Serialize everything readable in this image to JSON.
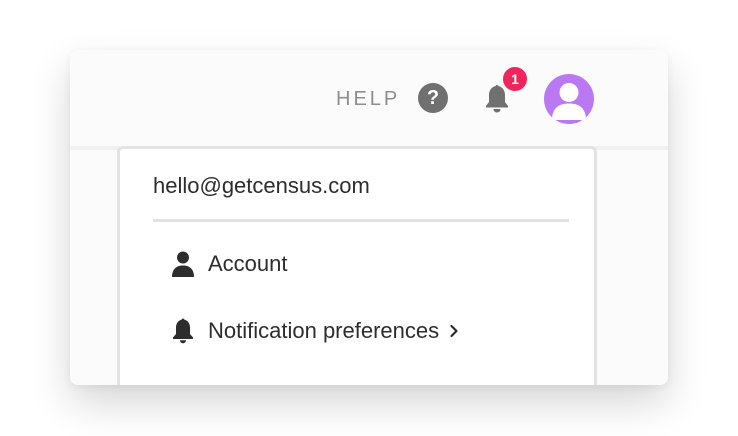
{
  "header": {
    "help_label": "HELP",
    "help_icon_glyph": "?",
    "help_icon_name": "question-circle-icon",
    "bell_icon_name": "bell-icon",
    "notification_count": "1",
    "avatar_icon_name": "user-avatar-icon"
  },
  "colors": {
    "accent_avatar": "#ba79f2",
    "badge": "#f0255b",
    "text_primary": "#2d2d2d",
    "text_muted": "#8e8e8e",
    "icon_gray": "#707070"
  },
  "dropdown": {
    "email": "hello@getcensus.com",
    "items": [
      {
        "label": "Account",
        "icon": "user-icon",
        "has_submenu": false
      },
      {
        "label": "Notification preferences",
        "icon": "bell-icon",
        "has_submenu": true
      }
    ]
  }
}
